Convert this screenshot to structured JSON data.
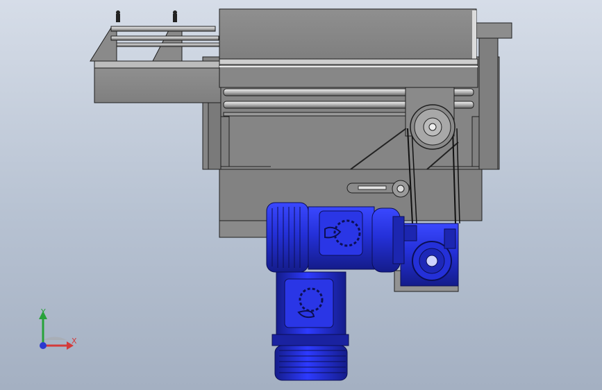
{
  "viewport": {
    "view": "Front",
    "background_top": "#d6dde8",
    "background_bottom": "#a4b0c2"
  },
  "model": {
    "frame_color": "#8c8c8c",
    "edge_color": "#202020",
    "motor_color": "#2430d8",
    "motor_dark": "#10167a",
    "components": [
      "conveyor-frame",
      "roller-housing",
      "drive-pulley",
      "tension-pulley",
      "v-belt",
      "gear-motor-horizontal",
      "gear-motor-vertical",
      "worm-gearbox",
      "mounting-plate"
    ]
  },
  "triad": {
    "x_label": "X",
    "y_label": "Y",
    "x_color": "#d43a3a",
    "y_color": "#27a23a",
    "z_color": "#2a3ad0"
  }
}
